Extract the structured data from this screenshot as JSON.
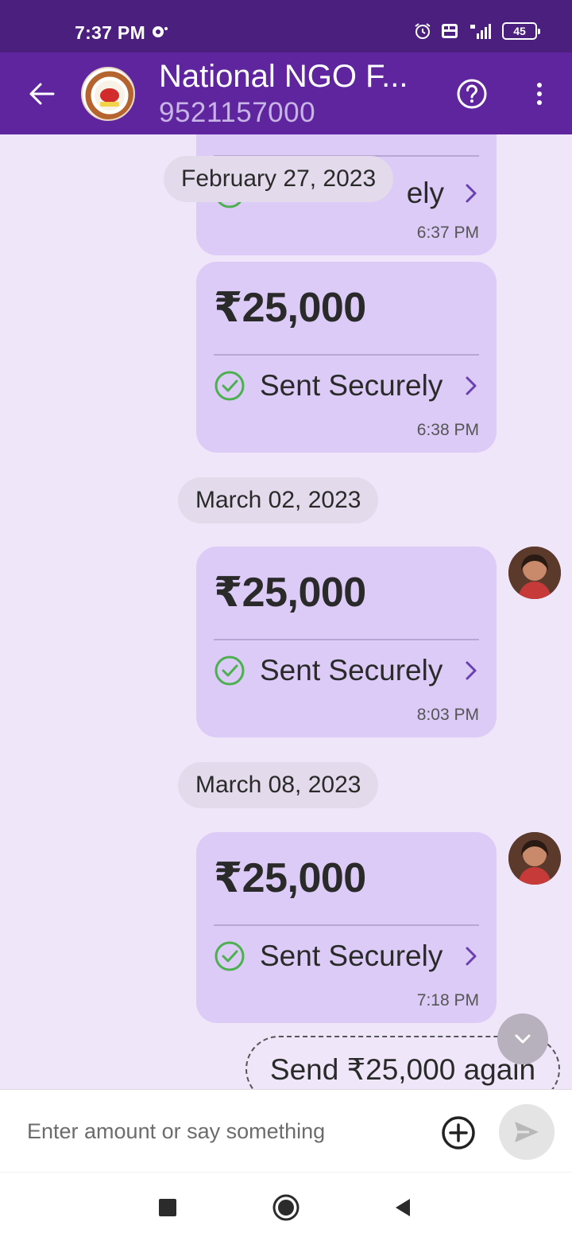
{
  "status_bar": {
    "time": "7:37 PM",
    "battery": "45",
    "icons": [
      "notification-icon",
      "alarm-icon",
      "volte-icon",
      "signal-4g-icon",
      "battery-icon"
    ]
  },
  "header": {
    "name": "National NGO F...",
    "phone": "9521157000",
    "colors": {
      "header_bg": "#5f259f",
      "status_bg": "#4a1f7e"
    }
  },
  "messages": [
    {
      "amount": "",
      "status": "",
      "time": "6:37 PM"
    },
    {
      "amount": "₹25,000",
      "status": "Sent Securely",
      "time": "6:38 PM"
    },
    {
      "amount": "₹25,000",
      "status": "Sent Securely",
      "time": "8:03 PM"
    },
    {
      "amount": "₹25,000",
      "status": "Sent Securely",
      "time": "7:18 PM"
    }
  ],
  "dates": [
    "February 27, 2023",
    "March 02, 2023",
    "March 08, 2023"
  ],
  "partial_status": "ely",
  "send_again": "Send ₹25,000 again",
  "input": {
    "placeholder": "Enter amount or say something"
  },
  "colors": {
    "bubble": "#dccbf6",
    "chat_bg": "#f0e6f9",
    "check": "#4caf50",
    "chevron": "#6a3fb0"
  }
}
